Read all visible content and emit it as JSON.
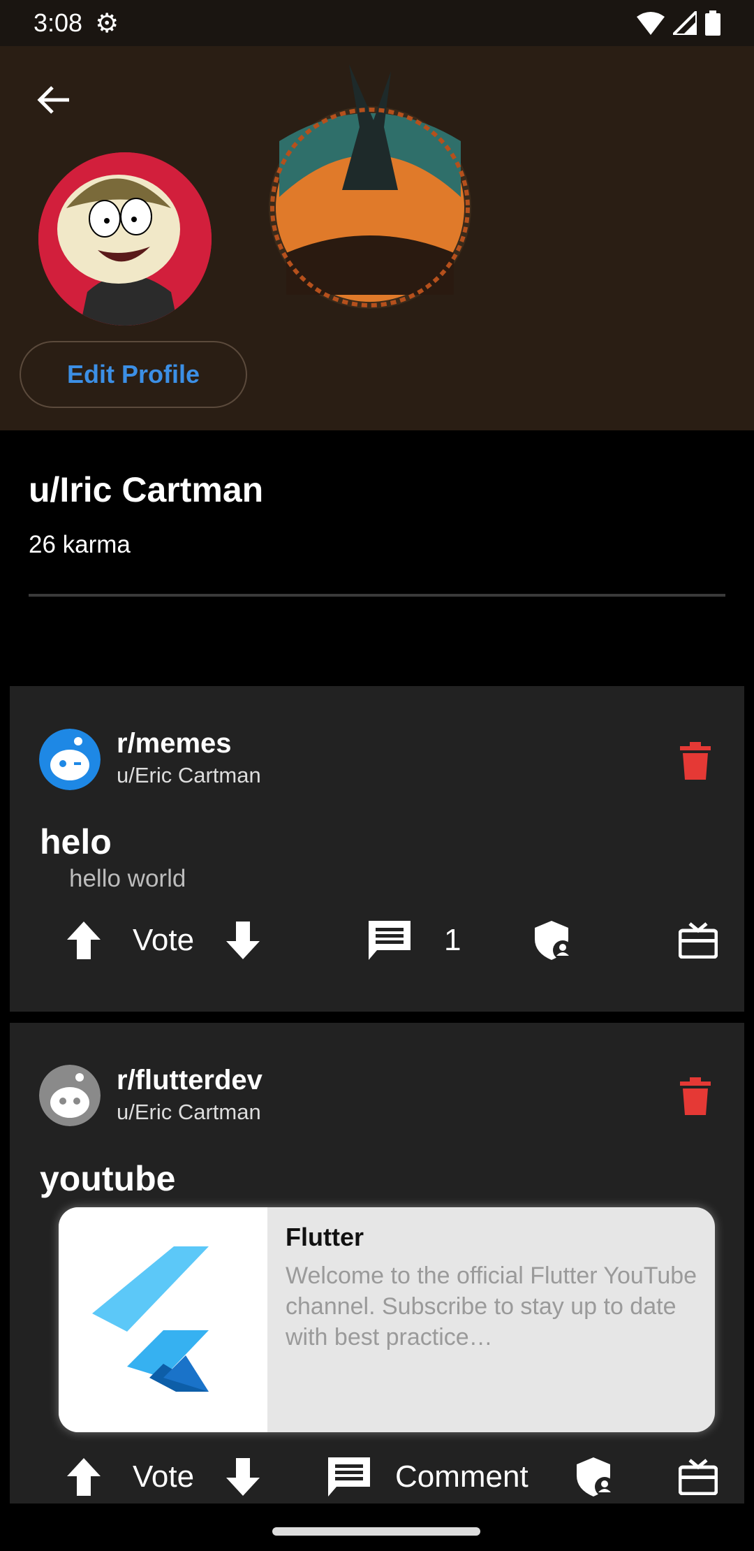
{
  "status_bar": {
    "time": "3:08"
  },
  "profile": {
    "edit_label": "Edit Profile",
    "username": "u/Iric Cartman",
    "karma": "26 karma"
  },
  "posts": [
    {
      "subreddit": "r/memes",
      "author": "u/Eric Cartman",
      "title": "helo",
      "body": "hello world",
      "vote_label": "Vote",
      "comment_count": "1"
    },
    {
      "subreddit": "r/flutterdev",
      "author": "u/Eric Cartman",
      "title": "youtube",
      "link": {
        "title": "Flutter",
        "description": "Welcome to the official Flutter YouTube channel. Subscribe to stay up to date with best practice…"
      },
      "vote_label": "Vote",
      "comment_label": "Comment"
    }
  ],
  "colors": {
    "accent": "#3c8fe5",
    "delete": "#e53935",
    "card": "#222222"
  }
}
